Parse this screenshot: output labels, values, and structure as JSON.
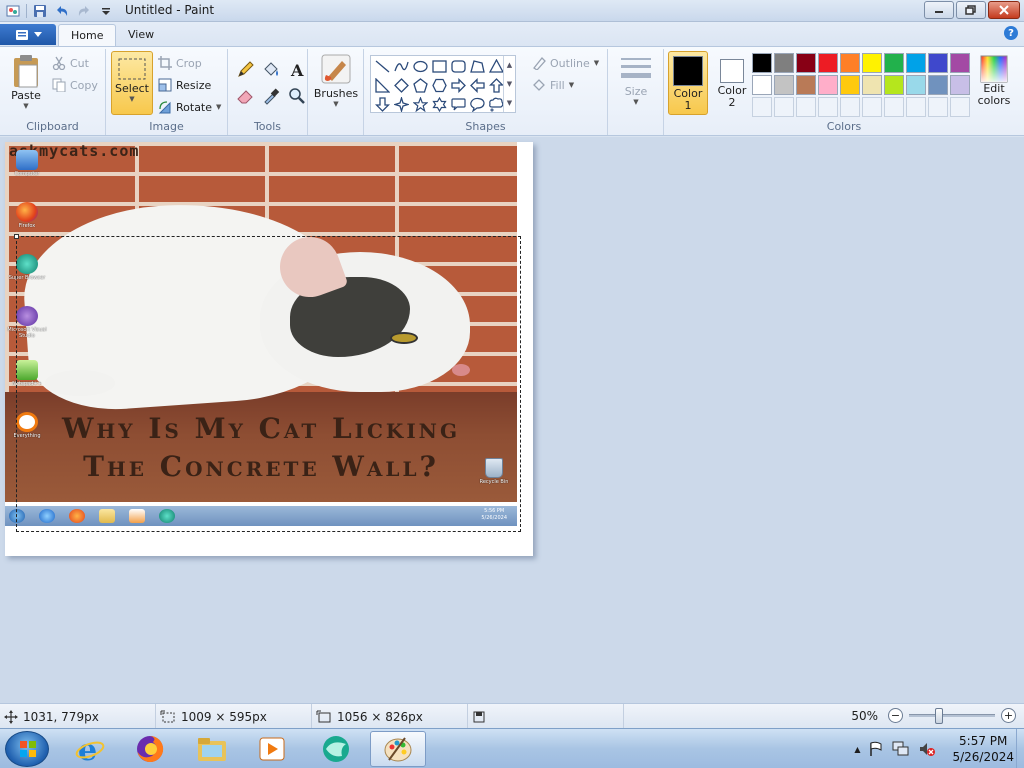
{
  "window": {
    "title": "Untitled - Paint"
  },
  "tabs": {
    "home": "Home",
    "view": "View"
  },
  "ribbon": {
    "clipboard": {
      "label": "Clipboard",
      "paste": "Paste",
      "cut": "Cut",
      "copy": "Copy"
    },
    "image": {
      "label": "Image",
      "select": "Select",
      "crop": "Crop",
      "resize": "Resize",
      "rotate": "Rotate"
    },
    "tools": {
      "label": "Tools",
      "brushes": "Brushes"
    },
    "shapes": {
      "label": "Shapes",
      "outline": "Outline",
      "fill": "Fill"
    },
    "size": {
      "label": "Size"
    },
    "colors": {
      "label": "Colors",
      "color1_line1": "Color",
      "color1_line2": "1",
      "color2_line1": "Color",
      "color2_line2": "2",
      "edit_line1": "Edit",
      "edit_line2": "colors",
      "color1_value": "#000000",
      "color2_value": "#ffffff",
      "palette": [
        "#000000",
        "#7f7f7f",
        "#880015",
        "#ed1c24",
        "#ff7f27",
        "#fff200",
        "#22b14c",
        "#00a2e8",
        "#3f48cc",
        "#a349a4",
        "#ffffff",
        "#c3c3c3",
        "#b97a57",
        "#ffaec9",
        "#ffc90e",
        "#efe4b0",
        "#b5e61d",
        "#99d9ea",
        "#7092be",
        "#c8bfe7"
      ]
    }
  },
  "canvas": {
    "watermark": "askmycats.com",
    "headline_line1": "Why Is My Cat Licking",
    "headline_line2": "The Concrete Wall?",
    "desktop_icons": [
      "Computer",
      "Firefox",
      "Super Browser",
      "Microsoft Visual Studio",
      "Notepad++",
      "Everything"
    ],
    "recycle_bin": "Recycle Bin",
    "mini_clock_time": "5:56 PM",
    "mini_clock_date": "5/26/2024"
  },
  "statusbar": {
    "cursor_pos": "1031, 779px",
    "selection_size": "1009 × 595px",
    "image_size": "1056 × 826px",
    "zoom": "50%",
    "zoom_percent": 50
  },
  "taskbar": {
    "time": "5:57 PM",
    "date": "5/26/2024"
  }
}
